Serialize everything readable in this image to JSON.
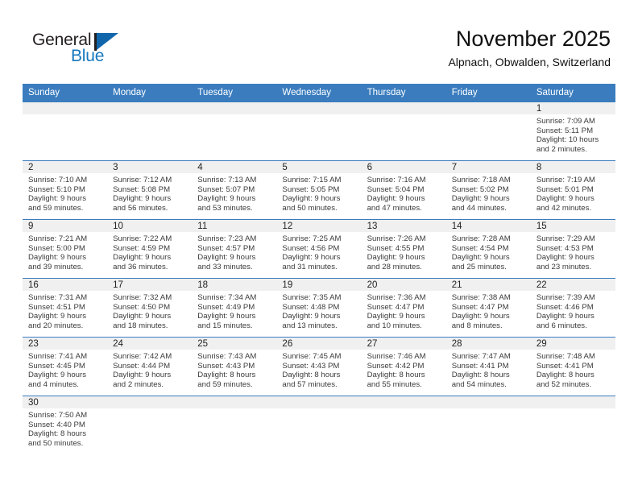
{
  "brand": {
    "name_part1": "General",
    "name_part2": "Blue",
    "flag_icon": "flag-triangle-icon",
    "accent_color": "#1878be"
  },
  "header": {
    "title": "November 2025",
    "subtitle": "Alpnach, Obwalden, Switzerland"
  },
  "calendar": {
    "header_bg": "#3a7cbe",
    "daynum_bg": "#f0f0f0",
    "weekdays": [
      "Sunday",
      "Monday",
      "Tuesday",
      "Wednesday",
      "Thursday",
      "Friday",
      "Saturday"
    ],
    "labels": {
      "sunrise": "Sunrise:",
      "sunset": "Sunset:",
      "daylight": "Daylight:"
    },
    "weeks": [
      [
        {
          "day": "",
          "blank": true
        },
        {
          "day": "",
          "blank": true
        },
        {
          "day": "",
          "blank": true
        },
        {
          "day": "",
          "blank": true
        },
        {
          "day": "",
          "blank": true
        },
        {
          "day": "",
          "blank": true
        },
        {
          "day": "1",
          "sunrise": "Sunrise: 7:09 AM",
          "sunset": "Sunset: 5:11 PM",
          "daylight1": "Daylight: 10 hours",
          "daylight2": "and 2 minutes."
        }
      ],
      [
        {
          "day": "2",
          "sunrise": "Sunrise: 7:10 AM",
          "sunset": "Sunset: 5:10 PM",
          "daylight1": "Daylight: 9 hours",
          "daylight2": "and 59 minutes."
        },
        {
          "day": "3",
          "sunrise": "Sunrise: 7:12 AM",
          "sunset": "Sunset: 5:08 PM",
          "daylight1": "Daylight: 9 hours",
          "daylight2": "and 56 minutes."
        },
        {
          "day": "4",
          "sunrise": "Sunrise: 7:13 AM",
          "sunset": "Sunset: 5:07 PM",
          "daylight1": "Daylight: 9 hours",
          "daylight2": "and 53 minutes."
        },
        {
          "day": "5",
          "sunrise": "Sunrise: 7:15 AM",
          "sunset": "Sunset: 5:05 PM",
          "daylight1": "Daylight: 9 hours",
          "daylight2": "and 50 minutes."
        },
        {
          "day": "6",
          "sunrise": "Sunrise: 7:16 AM",
          "sunset": "Sunset: 5:04 PM",
          "daylight1": "Daylight: 9 hours",
          "daylight2": "and 47 minutes."
        },
        {
          "day": "7",
          "sunrise": "Sunrise: 7:18 AM",
          "sunset": "Sunset: 5:02 PM",
          "daylight1": "Daylight: 9 hours",
          "daylight2": "and 44 minutes."
        },
        {
          "day": "8",
          "sunrise": "Sunrise: 7:19 AM",
          "sunset": "Sunset: 5:01 PM",
          "daylight1": "Daylight: 9 hours",
          "daylight2": "and 42 minutes."
        }
      ],
      [
        {
          "day": "9",
          "sunrise": "Sunrise: 7:21 AM",
          "sunset": "Sunset: 5:00 PM",
          "daylight1": "Daylight: 9 hours",
          "daylight2": "and 39 minutes."
        },
        {
          "day": "10",
          "sunrise": "Sunrise: 7:22 AM",
          "sunset": "Sunset: 4:59 PM",
          "daylight1": "Daylight: 9 hours",
          "daylight2": "and 36 minutes."
        },
        {
          "day": "11",
          "sunrise": "Sunrise: 7:23 AM",
          "sunset": "Sunset: 4:57 PM",
          "daylight1": "Daylight: 9 hours",
          "daylight2": "and 33 minutes."
        },
        {
          "day": "12",
          "sunrise": "Sunrise: 7:25 AM",
          "sunset": "Sunset: 4:56 PM",
          "daylight1": "Daylight: 9 hours",
          "daylight2": "and 31 minutes."
        },
        {
          "day": "13",
          "sunrise": "Sunrise: 7:26 AM",
          "sunset": "Sunset: 4:55 PM",
          "daylight1": "Daylight: 9 hours",
          "daylight2": "and 28 minutes."
        },
        {
          "day": "14",
          "sunrise": "Sunrise: 7:28 AM",
          "sunset": "Sunset: 4:54 PM",
          "daylight1": "Daylight: 9 hours",
          "daylight2": "and 25 minutes."
        },
        {
          "day": "15",
          "sunrise": "Sunrise: 7:29 AM",
          "sunset": "Sunset: 4:53 PM",
          "daylight1": "Daylight: 9 hours",
          "daylight2": "and 23 minutes."
        }
      ],
      [
        {
          "day": "16",
          "sunrise": "Sunrise: 7:31 AM",
          "sunset": "Sunset: 4:51 PM",
          "daylight1": "Daylight: 9 hours",
          "daylight2": "and 20 minutes."
        },
        {
          "day": "17",
          "sunrise": "Sunrise: 7:32 AM",
          "sunset": "Sunset: 4:50 PM",
          "daylight1": "Daylight: 9 hours",
          "daylight2": "and 18 minutes."
        },
        {
          "day": "18",
          "sunrise": "Sunrise: 7:34 AM",
          "sunset": "Sunset: 4:49 PM",
          "daylight1": "Daylight: 9 hours",
          "daylight2": "and 15 minutes."
        },
        {
          "day": "19",
          "sunrise": "Sunrise: 7:35 AM",
          "sunset": "Sunset: 4:48 PM",
          "daylight1": "Daylight: 9 hours",
          "daylight2": "and 13 minutes."
        },
        {
          "day": "20",
          "sunrise": "Sunrise: 7:36 AM",
          "sunset": "Sunset: 4:47 PM",
          "daylight1": "Daylight: 9 hours",
          "daylight2": "and 10 minutes."
        },
        {
          "day": "21",
          "sunrise": "Sunrise: 7:38 AM",
          "sunset": "Sunset: 4:47 PM",
          "daylight1": "Daylight: 9 hours",
          "daylight2": "and 8 minutes."
        },
        {
          "day": "22",
          "sunrise": "Sunrise: 7:39 AM",
          "sunset": "Sunset: 4:46 PM",
          "daylight1": "Daylight: 9 hours",
          "daylight2": "and 6 minutes."
        }
      ],
      [
        {
          "day": "23",
          "sunrise": "Sunrise: 7:41 AM",
          "sunset": "Sunset: 4:45 PM",
          "daylight1": "Daylight: 9 hours",
          "daylight2": "and 4 minutes."
        },
        {
          "day": "24",
          "sunrise": "Sunrise: 7:42 AM",
          "sunset": "Sunset: 4:44 PM",
          "daylight1": "Daylight: 9 hours",
          "daylight2": "and 2 minutes."
        },
        {
          "day": "25",
          "sunrise": "Sunrise: 7:43 AM",
          "sunset": "Sunset: 4:43 PM",
          "daylight1": "Daylight: 8 hours",
          "daylight2": "and 59 minutes."
        },
        {
          "day": "26",
          "sunrise": "Sunrise: 7:45 AM",
          "sunset": "Sunset: 4:43 PM",
          "daylight1": "Daylight: 8 hours",
          "daylight2": "and 57 minutes."
        },
        {
          "day": "27",
          "sunrise": "Sunrise: 7:46 AM",
          "sunset": "Sunset: 4:42 PM",
          "daylight1": "Daylight: 8 hours",
          "daylight2": "and 55 minutes."
        },
        {
          "day": "28",
          "sunrise": "Sunrise: 7:47 AM",
          "sunset": "Sunset: 4:41 PM",
          "daylight1": "Daylight: 8 hours",
          "daylight2": "and 54 minutes."
        },
        {
          "day": "29",
          "sunrise": "Sunrise: 7:48 AM",
          "sunset": "Sunset: 4:41 PM",
          "daylight1": "Daylight: 8 hours",
          "daylight2": "and 52 minutes."
        }
      ],
      [
        {
          "day": "30",
          "sunrise": "Sunrise: 7:50 AM",
          "sunset": "Sunset: 4:40 PM",
          "daylight1": "Daylight: 8 hours",
          "daylight2": "and 50 minutes."
        },
        {
          "day": "",
          "empty": true
        },
        {
          "day": "",
          "empty": true
        },
        {
          "day": "",
          "empty": true
        },
        {
          "day": "",
          "empty": true
        },
        {
          "day": "",
          "empty": true
        },
        {
          "day": "",
          "empty": true
        }
      ]
    ]
  }
}
